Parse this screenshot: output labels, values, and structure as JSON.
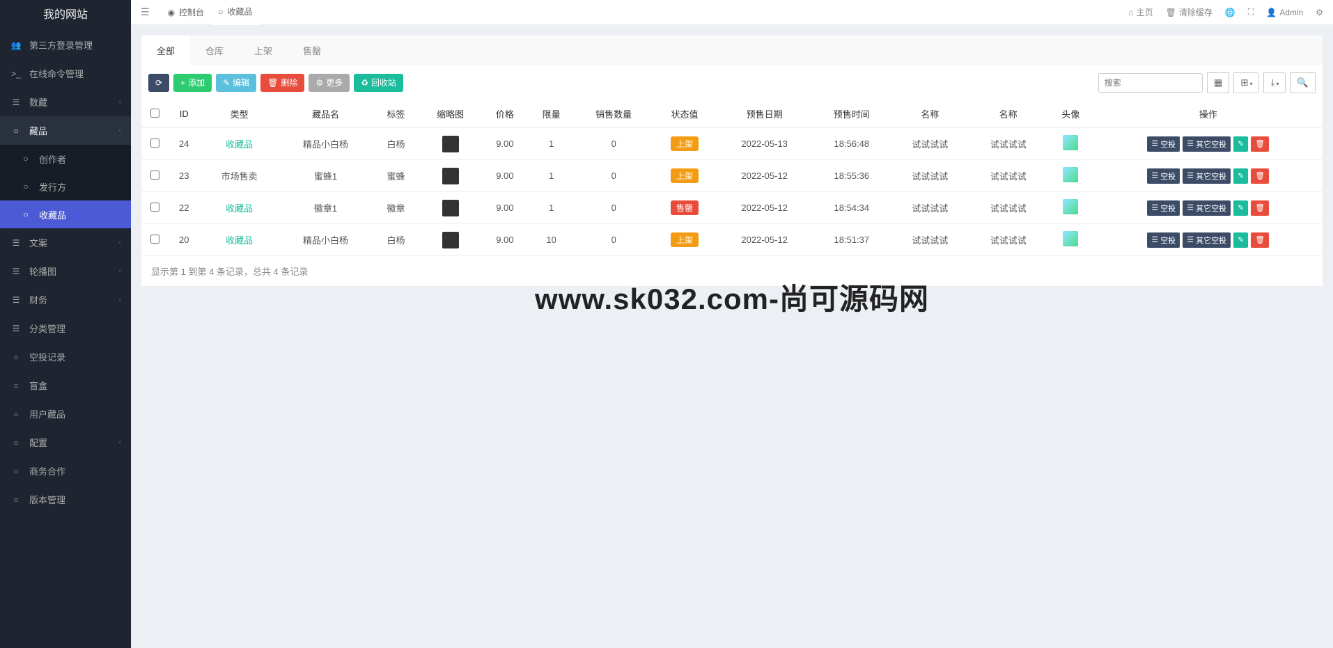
{
  "site": {
    "logo": "我的网站"
  },
  "sidebar": [
    {
      "icon": "👥",
      "label": "第三方登录管理",
      "expand": false
    },
    {
      "icon": ">_",
      "label": "在线命令管理",
      "expand": false
    },
    {
      "icon": "☰",
      "label": "数藏",
      "expand": true
    },
    {
      "icon": "○",
      "label": "藏品",
      "expand": true,
      "active": true,
      "sub": [
        {
          "icon": "○",
          "label": "创作者"
        },
        {
          "icon": "○",
          "label": "发行方"
        },
        {
          "icon": "○",
          "label": "收藏品",
          "selected": true
        }
      ]
    },
    {
      "icon": "☰",
      "label": "文案",
      "expand": true
    },
    {
      "icon": "☰",
      "label": "轮播图",
      "expand": true
    },
    {
      "icon": "☰",
      "label": "财务",
      "expand": true
    },
    {
      "icon": "☰",
      "label": "分类管理",
      "expand": false
    },
    {
      "icon": "○",
      "label": "空投记录",
      "expand": false
    },
    {
      "icon": "○",
      "label": "盲盒",
      "expand": false
    },
    {
      "icon": "○",
      "label": "用户藏品",
      "expand": false
    },
    {
      "icon": "○",
      "label": "配置",
      "expand": true
    },
    {
      "icon": "○",
      "label": "商务合作",
      "expand": false
    },
    {
      "icon": "○",
      "label": "版本管理",
      "expand": false
    }
  ],
  "topbar": {
    "tabs": [
      {
        "icon": "◉",
        "label": "控制台"
      },
      {
        "icon": "○",
        "label": "收藏品",
        "active": true
      }
    ],
    "right": {
      "home": "主页",
      "clearCache": "清除缓存",
      "user": "Admin"
    }
  },
  "panel": {
    "tabs": [
      {
        "label": "全部",
        "active": true
      },
      {
        "label": "仓库"
      },
      {
        "label": "上架"
      },
      {
        "label": "售罄"
      }
    ],
    "toolbar": {
      "add": "添加",
      "edit": "编辑",
      "delete": "删除",
      "more": "更多",
      "recycle": "回收站",
      "searchPlaceholder": "搜索"
    },
    "headers": [
      "ID",
      "类型",
      "藏品名",
      "标签",
      "缩略图",
      "价格",
      "限量",
      "销售数量",
      "状态值",
      "预售日期",
      "预售时间",
      "名称",
      "名称",
      "头像",
      "操作"
    ],
    "rows": [
      {
        "id": "24",
        "type": "收藏品",
        "typeLink": true,
        "name": "精品小白杨",
        "tag": "白杨",
        "price": "9.00",
        "limit": "1",
        "sold": "0",
        "status": "上架",
        "statusClass": "badge-orange",
        "date": "2022-05-13",
        "time": "18:56:48",
        "n1": "试试试试",
        "n2": "试试试试"
      },
      {
        "id": "23",
        "type": "市场售卖",
        "typeLink": false,
        "name": "蜜蜂1",
        "tag": "蜜蜂",
        "price": "9.00",
        "limit": "1",
        "sold": "0",
        "status": "上架",
        "statusClass": "badge-orange",
        "date": "2022-05-12",
        "time": "18:55:36",
        "n1": "试试试试",
        "n2": "试试试试"
      },
      {
        "id": "22",
        "type": "收藏品",
        "typeLink": true,
        "name": "徽章1",
        "tag": "徽章",
        "price": "9.00",
        "limit": "1",
        "sold": "0",
        "status": "售罄",
        "statusClass": "badge-red",
        "date": "2022-05-12",
        "time": "18:54:34",
        "n1": "试试试试",
        "n2": "试试试试"
      },
      {
        "id": "20",
        "type": "收藏品",
        "typeLink": true,
        "name": "精品小白杨",
        "tag": "白杨",
        "price": "9.00",
        "limit": "10",
        "sold": "0",
        "status": "上架",
        "statusClass": "badge-orange",
        "date": "2022-05-12",
        "time": "18:51:37",
        "n1": "试试试试",
        "n2": "试试试试"
      }
    ],
    "actions": {
      "airdrop": "空投",
      "otherAirdrop": "其它空投"
    },
    "recordInfo": "显示第 1 到第 4 条记录，总共 4 条记录"
  },
  "watermark": "www.sk032.com-尚可源码网"
}
